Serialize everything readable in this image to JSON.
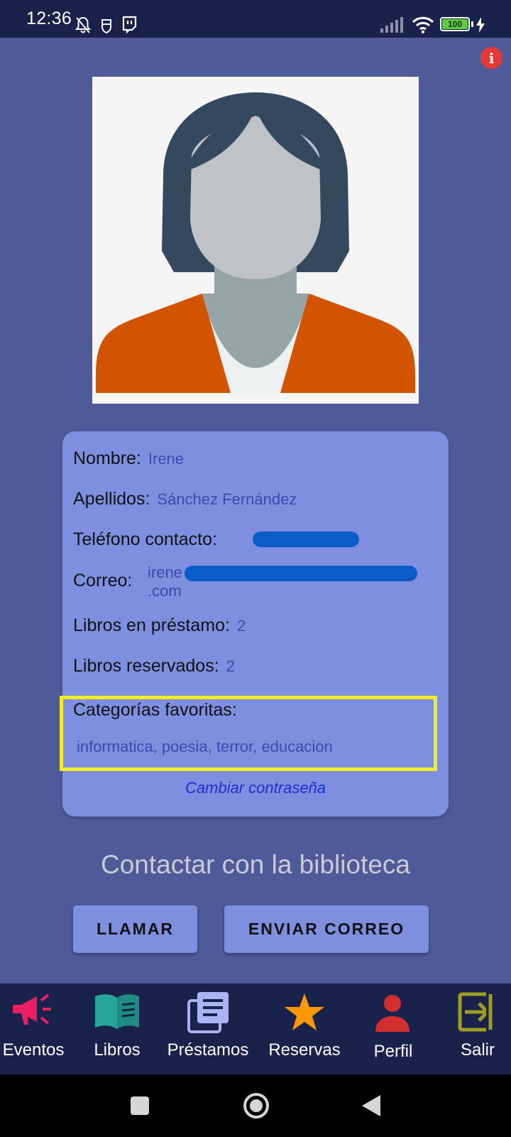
{
  "status_bar": {
    "time": "12:36",
    "battery": "100"
  },
  "profile": {
    "fields": [
      {
        "label": "Nombre:",
        "value": "Irene"
      },
      {
        "label": "Apellidos:",
        "value": "Sánchez Fernández"
      },
      {
        "label": "Teléfono contacto:",
        "value": ""
      },
      {
        "label": "Correo:",
        "value_line1": "irene",
        "value_line2": ".com"
      },
      {
        "label": "Libros en préstamo:",
        "value": "2"
      },
      {
        "label": "Libros reservados:",
        "value": "2"
      }
    ],
    "favorites": {
      "label": "Categorías favoritas:",
      "value": "informatica, poesia, terror, educacion"
    },
    "change_password": "Cambiar contraseña"
  },
  "contact": {
    "title": "Contactar con la biblioteca",
    "call_button": "LLAMAR",
    "email_button": "ENVIAR CORREO"
  },
  "bottom_nav": [
    {
      "label": "Eventos",
      "icon": "megaphone-icon",
      "color": "#e91e63"
    },
    {
      "label": "Libros",
      "icon": "book-icon",
      "color": "#26a69a"
    },
    {
      "label": "Préstamos",
      "icon": "documents-icon",
      "color": "#aab4f5"
    },
    {
      "label": "Reservas",
      "icon": "star-icon",
      "color": "#ff9800"
    },
    {
      "label": "Perfil",
      "icon": "person-icon",
      "color": "#d32f2f"
    },
    {
      "label": "Salir",
      "icon": "exit-icon",
      "color": "#9e9d24"
    }
  ],
  "colors": {
    "background": "#4f5a99",
    "card": "#7f8fe0",
    "nav_bar": "#19224a",
    "highlight": "#f2ec27",
    "value_text": "#3d4aa8",
    "link": "#1a2fcf"
  }
}
